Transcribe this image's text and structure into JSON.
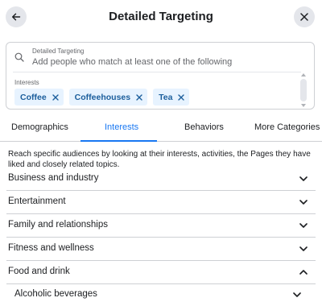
{
  "header": {
    "title": "Detailed Targeting",
    "back_icon": "arrow-left-icon",
    "close_icon": "close-icon"
  },
  "search": {
    "label": "Detailed Targeting",
    "placeholder": "Add people who match at least one of the following",
    "value": ""
  },
  "interests": {
    "label": "Interests",
    "chips": [
      {
        "label": "Coffee"
      },
      {
        "label": "Coffeehouses"
      },
      {
        "label": "Tea"
      }
    ]
  },
  "tabs": [
    {
      "label": "Demographics",
      "active": false
    },
    {
      "label": "Interests",
      "active": true
    },
    {
      "label": "Behaviors",
      "active": false
    },
    {
      "label": "More Categories",
      "active": false
    }
  ],
  "description": "Reach specific audiences by looking at their interests, activities, the Pages they have liked and closely related topics.",
  "categories": [
    {
      "label": "Business and industry",
      "expanded": false
    },
    {
      "label": "Entertainment",
      "expanded": false
    },
    {
      "label": "Family and relationships",
      "expanded": false
    },
    {
      "label": "Fitness and wellness",
      "expanded": false
    },
    {
      "label": "Food and drink",
      "expanded": true
    },
    {
      "label": "Alcoholic beverages",
      "expanded": false
    }
  ],
  "colors": {
    "accent": "#1877f2",
    "chip_bg": "#e7f3ff",
    "chip_text": "#1b5e9c",
    "icon_button_bg": "#e4e6eb"
  }
}
